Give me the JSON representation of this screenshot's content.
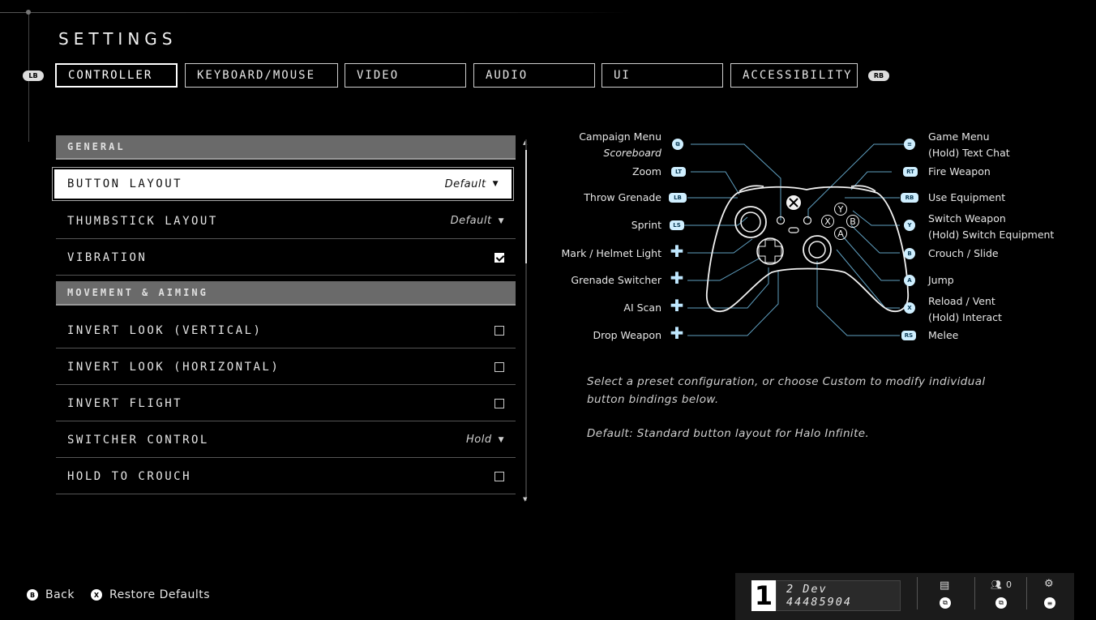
{
  "header": {
    "title": "SETTINGS",
    "lb": "LB",
    "rb": "RB"
  },
  "tabs": [
    {
      "label": "CONTROLLER",
      "active": true
    },
    {
      "label": "KEYBOARD/MOUSE",
      "active": false
    },
    {
      "label": "VIDEO",
      "active": false
    },
    {
      "label": "AUDIO",
      "active": false
    },
    {
      "label": "UI",
      "active": false
    },
    {
      "label": "ACCESSIBILITY",
      "active": false
    }
  ],
  "sections": {
    "general": "GENERAL",
    "movement": "MOVEMENT & AIMING"
  },
  "settings": {
    "button_layout": {
      "label": "BUTTON LAYOUT",
      "value": "Default"
    },
    "thumbstick_layout": {
      "label": "THUMBSTICK LAYOUT",
      "value": "Default"
    },
    "vibration": {
      "label": "VIBRATION",
      "checked": true
    },
    "invert_look_vertical": {
      "label": "INVERT LOOK (VERTICAL)",
      "checked": false
    },
    "invert_look_horizontal": {
      "label": "INVERT LOOK (HORIZONTAL)",
      "checked": false
    },
    "invert_flight": {
      "label": "INVERT FLIGHT",
      "checked": false
    },
    "switcher_control": {
      "label": "SWITCHER CONTROL",
      "value": "Hold"
    },
    "hold_to_crouch": {
      "label": "HOLD TO CROUCH",
      "checked": false
    }
  },
  "controller_map": {
    "left": {
      "campaign_menu": "Campaign Menu",
      "scoreboard": "Scoreboard",
      "zoom": "Zoom",
      "throw_grenade": "Throw Grenade",
      "sprint": "Sprint",
      "mark": "Mark / Helmet Light",
      "grenade_switcher": "Grenade Switcher",
      "ai_scan": "AI Scan",
      "drop_weapon": "Drop Weapon"
    },
    "right": {
      "game_menu": "Game Menu",
      "text_chat": "(Hold) Text Chat",
      "fire_weapon": "Fire Weapon",
      "use_equipment": "Use Equipment",
      "switch_weapon": "Switch Weapon",
      "switch_equipment": "(Hold) Switch Equipment",
      "crouch": "Crouch / Slide",
      "jump": "Jump",
      "reload": "Reload / Vent",
      "interact": "(Hold) Interact",
      "melee": "Melee"
    },
    "pins": {
      "lt": "LT",
      "lb": "LB",
      "rt": "RT",
      "rb": "RB",
      "ls": "LS",
      "rs": "RS",
      "y": "Y",
      "b": "B",
      "a": "A",
      "x": "X"
    },
    "face_buttons": {
      "y": "Y",
      "b": "B",
      "a": "A",
      "x": "X"
    }
  },
  "description": {
    "line1": "Select a preset configuration, or choose Custom to modify individual",
    "line2": "button bindings below.",
    "line3": "Default: Standard button layout for Halo Infinite."
  },
  "footer": {
    "back_btn": "B",
    "back_label": "Back",
    "restore_btn": "X",
    "restore_label": "Restore Defaults"
  },
  "status": {
    "tier": "1",
    "player": "2 Dev 44485904",
    "friends_count": "0"
  }
}
